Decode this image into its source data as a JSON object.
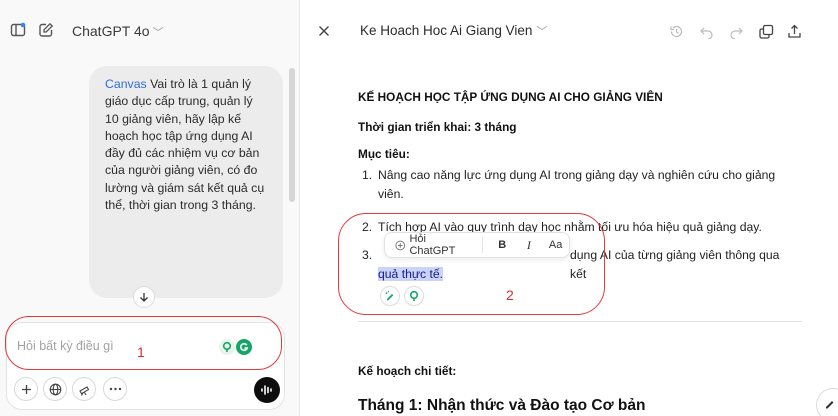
{
  "left_panel": {
    "model_name": "ChatGPT 4o",
    "message": {
      "tag": "Canvas",
      "text": " Vai trò là 1 quản lý giáo dục cấp trung, quản lý 10 giảng viên, hãy lập kế hoạch học tập ứng dụng AI đầy đủ các nhiệm vụ cơ bản của người giảng viên, có đo lường và giám sát kết quả cụ thể, thời gian trong 3 tháng."
    },
    "composer": {
      "placeholder": "Hỏi bất kỳ điều gì"
    }
  },
  "annotations": {
    "label_1": "1",
    "label_2": "2",
    "color": "#e23b3b"
  },
  "canvas": {
    "title": "Ke Hoach Hoc Ai Giang Vien",
    "heading": "KẾ HOẠCH HỌC TẬP ỨNG DỤNG AI CHO GIẢNG VIÊN",
    "duration": "Thời gian triển khai: 3 tháng",
    "goals_label": "Mục tiêu:",
    "goals": [
      {
        "n": "1.",
        "text": "Nâng cao năng lực ứng dụng AI trong giảng dạy và nghiên cứu cho giảng viên."
      },
      {
        "n": "2.",
        "text": "Tích hợp AI vào quy trình dạy học nhằm tối ưu hóa hiệu quả giảng dạy."
      },
      {
        "n": "3.",
        "text_visible": "dụng AI của từng giảng viên thông qua kết",
        "text_highlight": "quả thực tế."
      }
    ],
    "detail_label": "Kế hoạch chi tiết:",
    "month1": "Tháng 1: Nhận thức và Đào tạo Cơ bản",
    "popover": {
      "ask_label": "Hỏi ChatGPT",
      "bold": "B",
      "italic": "I",
      "size": "Aa"
    }
  },
  "colors": {
    "accent_blue": "#2f6fd1",
    "highlight": "#c9d4f7",
    "grammarly_green": "#15a566"
  }
}
